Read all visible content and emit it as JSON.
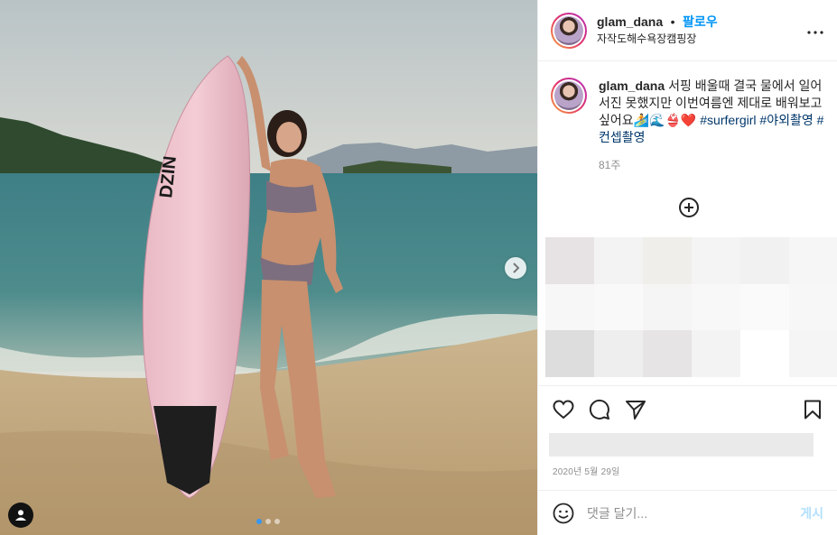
{
  "post": {
    "username": "glam_dana",
    "separator": "•",
    "follow_label": "팔로우",
    "location": "자작도해수욕장캠핑장",
    "more_icon": "more-horizontal-icon"
  },
  "caption": {
    "username": "glam_dana",
    "text": "서핑 배울때 결국 물에서 일어서진 못했지만 이번여름엔 제대로 배워보고싶어요🏄🌊👙❤️",
    "hashtags": [
      "#surfergirl",
      "#야외촬영",
      "#컨셉촬영"
    ],
    "time_ago": "81주"
  },
  "photo": {
    "board_brand": "DZIN",
    "dots": [
      true,
      false,
      false
    ]
  },
  "actions": {
    "icons": [
      "heart-icon",
      "comment-icon",
      "share-icon",
      "bookmark-icon"
    ]
  },
  "date": "2020년 5월 29일",
  "comment": {
    "placeholder": "댓글 달기...",
    "post_label": "게시"
  },
  "colors": {
    "accent": "#0095f6",
    "hashtag": "#00376b",
    "post_disabled": "#b2dffc",
    "slide_dot_active": "#3897f0"
  }
}
